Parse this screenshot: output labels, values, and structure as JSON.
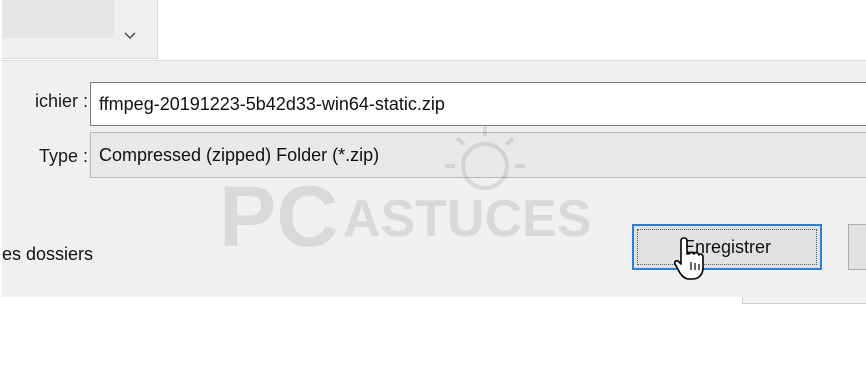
{
  "dialog": {
    "filename_label": "ichier :",
    "filename_value": "ffmpeg-20191223-5b42d33-win64-static.zip",
    "type_label": "Type :",
    "type_value": "Compressed (zipped) Folder (*.zip)",
    "hide_folders_label": "es dossiers",
    "save_label": "Enregistrer"
  },
  "watermark": {
    "text_primary": "PC",
    "text_secondary": "ASTUCES"
  },
  "icons": {
    "combo": "chevron-down-icon",
    "cursor": "mouse-pointer-icon"
  },
  "colors": {
    "focus_border": "#2a7fd8",
    "panel": "#f0f0f0"
  }
}
